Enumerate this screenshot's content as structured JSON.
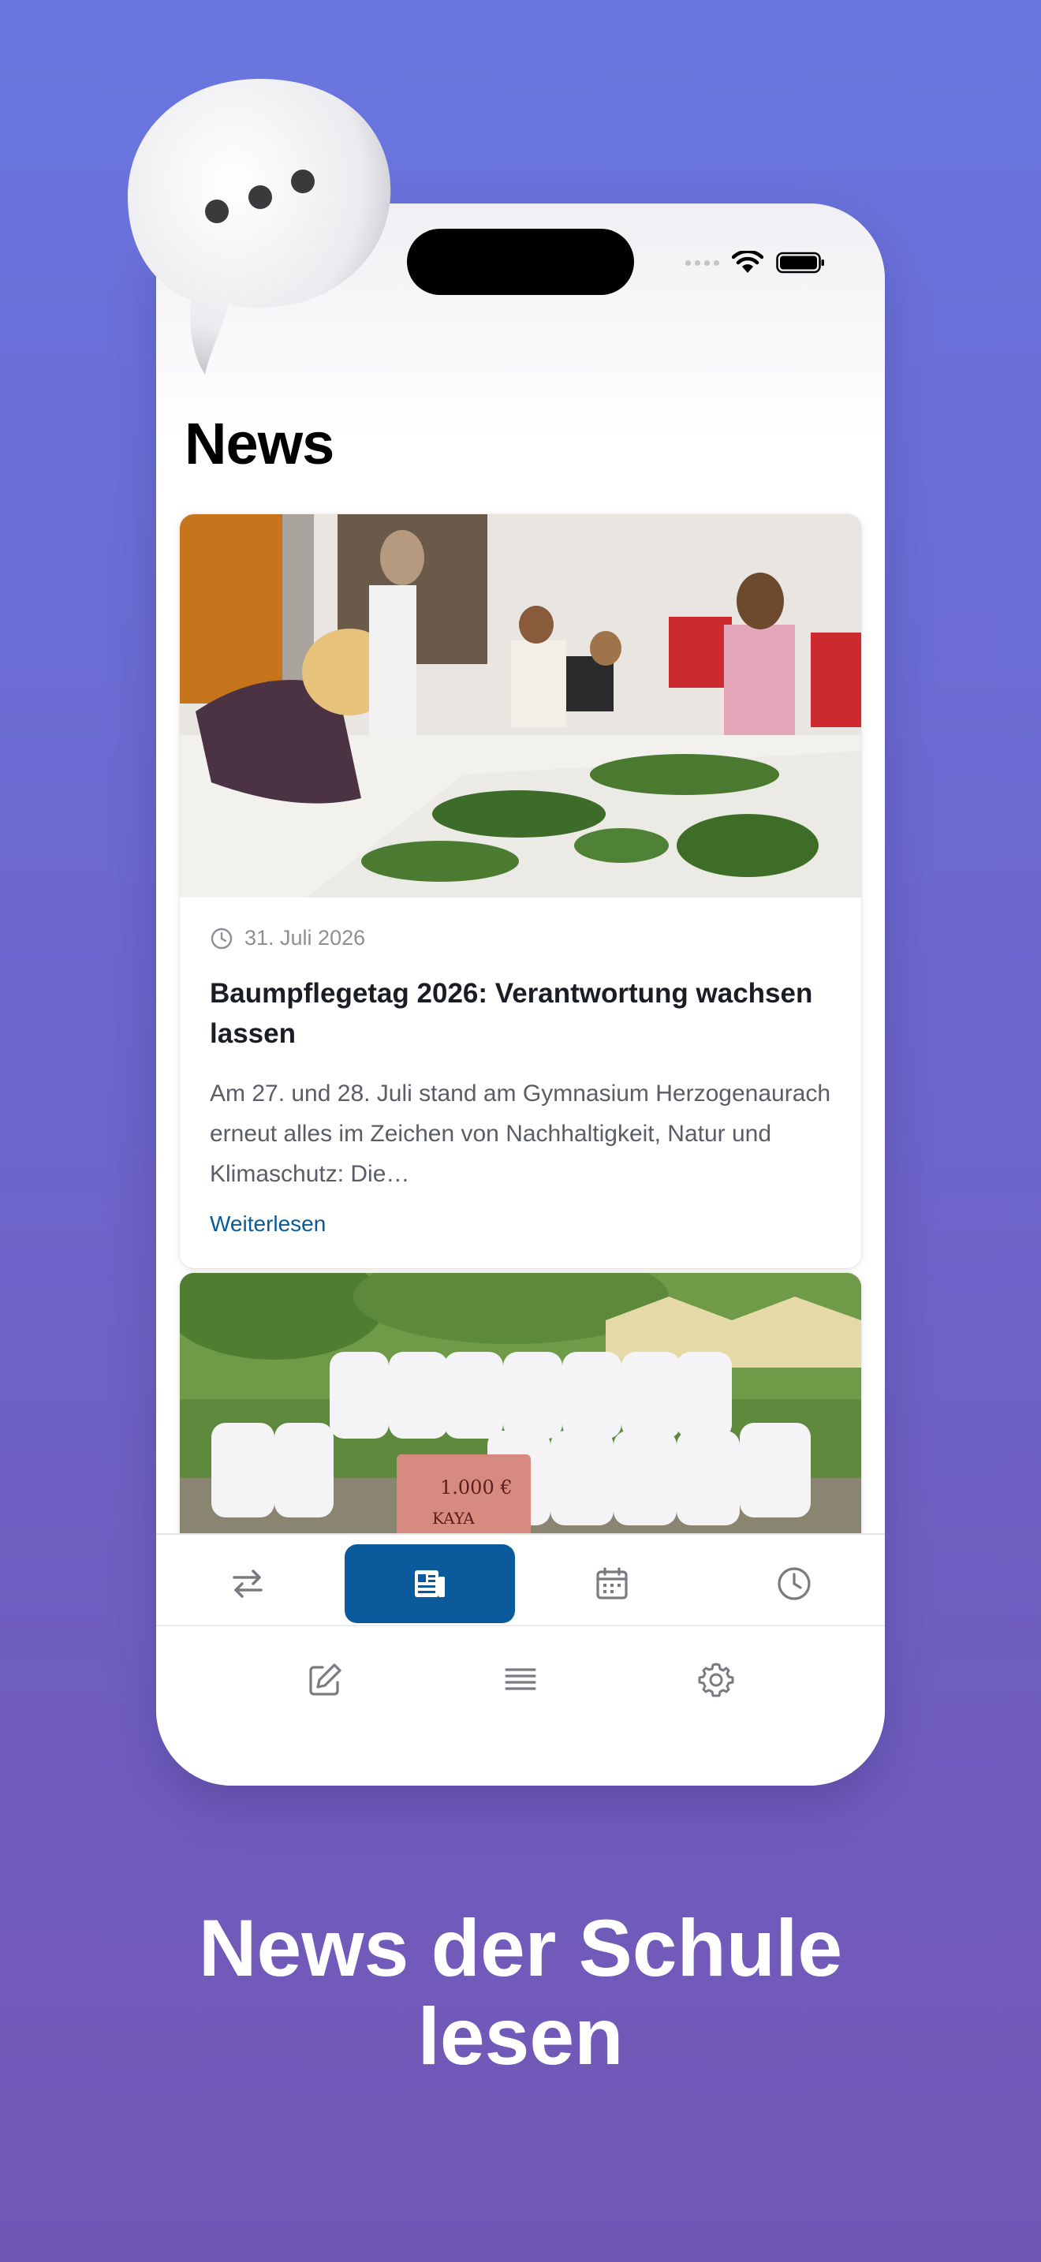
{
  "colors": {
    "accent": "#0b5a9b",
    "link": "#0a5a9a",
    "background_top": "#6a76e0",
    "background_bottom": "#7256b4"
  },
  "header": {
    "title": "News"
  },
  "articles": [
    {
      "date": "31. Juli 2026",
      "headline": "Baumpflegetag 2026: Verantwortung wachsen lassen",
      "excerpt": "Am 27. und 28. Juli stand am Gymnasium Herzogenaurach erneut alles im Zeichen von Nachhaltigkeit, Natur und Klimaschutz: Die…",
      "read_more": "Weiterlesen",
      "image": "students-with-plants-photo"
    },
    {
      "image": "group-photo-students-white-shirts",
      "check_amount": "1.000 €",
      "check_recipient": "KAYA"
    }
  ],
  "tabbar": {
    "row1": [
      {
        "icon": "swap-arrows-icon",
        "active": false
      },
      {
        "icon": "newspaper-icon",
        "active": true
      },
      {
        "icon": "calendar-icon",
        "active": false
      },
      {
        "icon": "clock-icon",
        "active": false
      }
    ],
    "row2": [
      {
        "icon": "edit-icon",
        "active": false
      },
      {
        "icon": "list-icon",
        "active": false
      },
      {
        "icon": "gear-icon",
        "active": false
      }
    ]
  },
  "caption": {
    "line1": "News der Schule",
    "line2": "lesen"
  }
}
